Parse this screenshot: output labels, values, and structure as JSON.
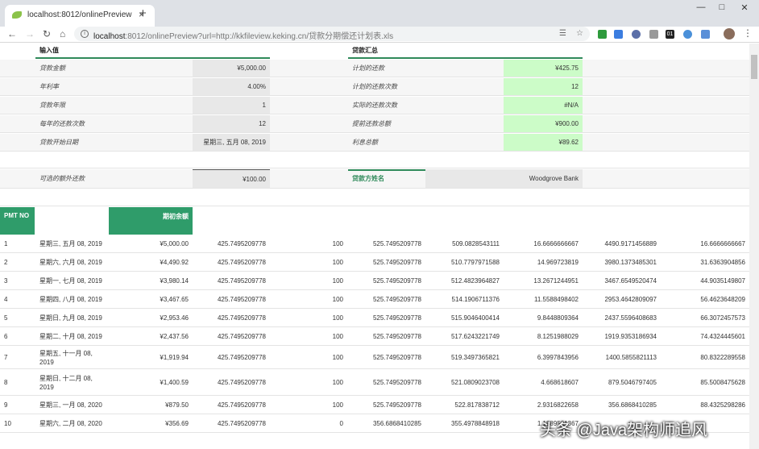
{
  "browser": {
    "tab_title": "localhost:8012/onlinePreview",
    "tab_close": "×",
    "new_tab": "+",
    "url_host": "localhost",
    "url_rest": ":8012/onlinePreview?url=http://kkfileview.keking.cn/贷款分期偿还计划表.xls",
    "ext_label_01": "01",
    "avatar_label": "账号"
  },
  "inputs": {
    "header": "输入值",
    "rows": [
      {
        "label": "贷款金额",
        "value": "¥5,000.00"
      },
      {
        "label": "年利率",
        "value": "4.00%"
      },
      {
        "label": "贷款年限",
        "value": "1"
      },
      {
        "label": "每年的还款次数",
        "value": "12"
      },
      {
        "label": "贷款开始日期",
        "value": "星期三, 五月 08, 2019"
      }
    ],
    "extra_label": "可选的额外还款",
    "extra_value": "¥100.00"
  },
  "summary": {
    "header": "贷款汇总",
    "rows": [
      {
        "label": "计划的还款",
        "value": "¥425.75"
      },
      {
        "label": "计划的还款次数",
        "value": "12"
      },
      {
        "label": "实际的还款次数",
        "value": "#N/A"
      },
      {
        "label": "提前还款总额",
        "value": "¥900.00"
      },
      {
        "label": "利息总额",
        "value": "¥89.62"
      }
    ],
    "lender_label": "贷款方姓名",
    "lender_value": "Woodgrove Bank"
  },
  "table": {
    "col_pmt": "PMT NO",
    "col_begin": "期初余额",
    "rows": [
      [
        "1",
        "星期三, 五月 08, 2019",
        "¥5,000.00",
        "425.7495209778",
        "100",
        "525.7495209778",
        "509.0828543111",
        "16.6666666667",
        "4490.9171456889",
        "16.6666666667"
      ],
      [
        "2",
        "星期六, 六月 08, 2019",
        "¥4,490.92",
        "425.7495209778",
        "100",
        "525.7495209778",
        "510.7797971588",
        "14.969723819",
        "3980.1373485301",
        "31.6363904856"
      ],
      [
        "3",
        "星期一, 七月 08, 2019",
        "¥3,980.14",
        "425.7495209778",
        "100",
        "525.7495209778",
        "512.4823964827",
        "13.2671244951",
        "3467.6549520474",
        "44.9035149807"
      ],
      [
        "4",
        "星期四, 八月 08, 2019",
        "¥3,467.65",
        "425.7495209778",
        "100",
        "525.7495209778",
        "514.1906711376",
        "11.5588498402",
        "2953.4642809097",
        "56.4623648209"
      ],
      [
        "5",
        "星期日, 九月 08, 2019",
        "¥2,953.46",
        "425.7495209778",
        "100",
        "525.7495209778",
        "515.9046400414",
        "9.8448809364",
        "2437.5596408683",
        "66.3072457573"
      ],
      [
        "6",
        "星期二, 十月 08, 2019",
        "¥2,437.56",
        "425.7495209778",
        "100",
        "525.7495209778",
        "517.6243221749",
        "8.1251988029",
        "1919.9353186934",
        "74.4324445601"
      ],
      [
        "7",
        "星期五, 十一月 08, 2019",
        "¥1,919.94",
        "425.7495209778",
        "100",
        "525.7495209778",
        "519.3497365821",
        "6.3997843956",
        "1400.5855821113",
        "80.8322289558"
      ],
      [
        "8",
        "星期日, 十二月 08, 2019",
        "¥1,400.59",
        "425.7495209778",
        "100",
        "525.7495209778",
        "521.0809023708",
        "4.668618607",
        "879.5046797405",
        "85.5008475628"
      ],
      [
        "9",
        "星期三, 一月 08, 2020",
        "¥879.50",
        "425.7495209778",
        "100",
        "525.7495209778",
        "522.817838712",
        "2.9316822658",
        "356.6868410285",
        "88.4325298286"
      ],
      [
        "10",
        "星期六, 二月 08, 2020",
        "¥356.69",
        "425.7495209778",
        "0",
        "356.6868410285",
        "355.4978848918",
        "1.1889561367",
        "",
        ""
      ]
    ]
  },
  "watermark": "头条 @Java架构师追风",
  "colors": {
    "header_green": "#2f9c6a",
    "result_green": "#ccfcc8",
    "input_gray": "#e8e8e8"
  }
}
